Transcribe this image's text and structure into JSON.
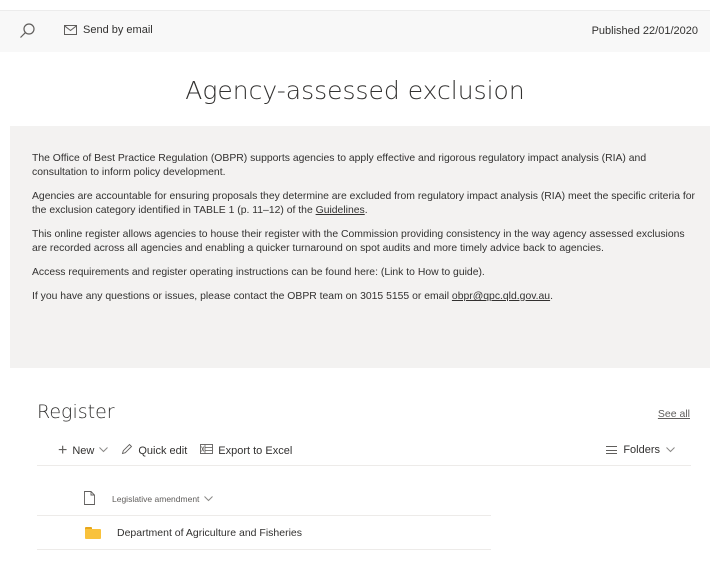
{
  "topbar": {
    "send_label": "Send by email",
    "published": "Published 22/01/2020"
  },
  "page": {
    "title": "Agency-assessed exclusion"
  },
  "info": {
    "p1": "The Office of Best Practice Regulation (OBPR) supports agencies to apply effective and rigorous regulatory impact analysis (RIA) and consultation to inform policy development.",
    "p2_before": "Agencies are accountable for ensuring proposals they determine are excluded from regulatory impact analysis (RIA) meet the specific criteria for the exclusion category identified in TABLE 1 (p. 11–12) of the ",
    "p2_link": "Guidelines",
    "p2_after": ".",
    "p3": "This online register allows agencies to house their register with the Commission providing consistency in the way agency assessed exclusions are recorded across all agencies and enabling a quicker turnaround on spot audits and more timely advice back to agencies.",
    "p4": "Access requirements and register operating instructions can be found here: (Link to How to guide).",
    "p5_before": "If you have any questions or issues, please contact the OBPR team on 3015 5155 or email ",
    "p5_link": "obpr@qpc.qld.gov.au",
    "p5_after": "."
  },
  "register": {
    "title": "Register",
    "see_all": "See all",
    "commands": {
      "new_label": "New",
      "quick_edit_label": "Quick edit",
      "export_label": "Export to Excel",
      "folders_label": "Folders"
    },
    "column_header": "Legislative amendment",
    "rows": [
      {
        "name": "Department of Agriculture and Fisheries"
      }
    ]
  },
  "icons": {
    "search": "search-icon",
    "mail": "mail-icon",
    "plus": "plus-icon",
    "pencil": "pencil-icon",
    "excel": "excel-icon",
    "view": "list-view-icon",
    "document": "document-icon",
    "folder": "folder-icon"
  },
  "colors": {
    "info_background": "#f3f2f1",
    "folder_yellow": "#f9c23c",
    "text": "#323130"
  }
}
